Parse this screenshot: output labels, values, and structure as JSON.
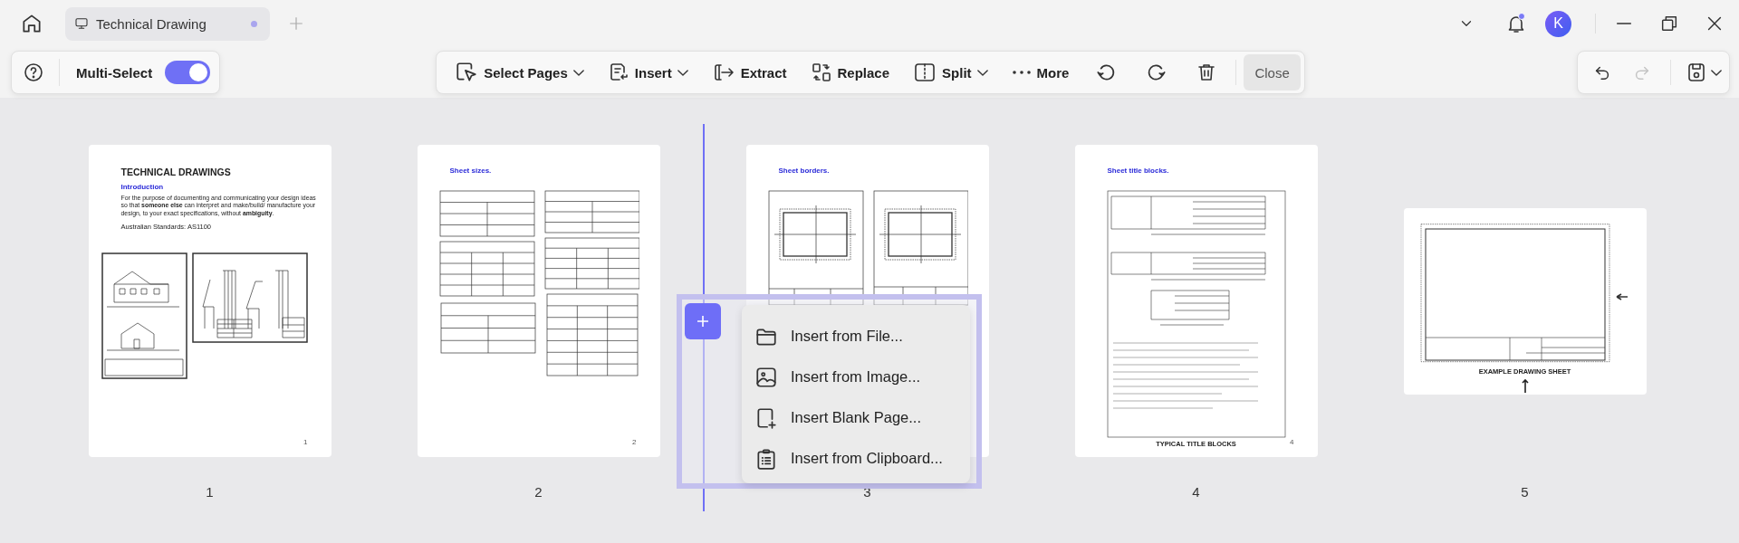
{
  "tab": {
    "title": "Technical Drawing",
    "unsaved": true
  },
  "notifications": {
    "unread": true
  },
  "avatar": {
    "initial": "K"
  },
  "multi_select": {
    "label": "Multi-Select",
    "on": true
  },
  "toolbar": [
    {
      "kind": "dropdown",
      "label": "Select Pages"
    },
    {
      "kind": "dropdown",
      "label": "Insert"
    },
    {
      "kind": "action",
      "label": "Extract"
    },
    {
      "kind": "action",
      "label": "Replace"
    },
    {
      "kind": "dropdown",
      "label": "Split"
    },
    {
      "kind": "action",
      "label": "More"
    },
    {
      "kind": "icon"
    },
    {
      "kind": "icon"
    },
    {
      "kind": "icon"
    },
    {
      "kind": "button",
      "label": "Close"
    }
  ],
  "history": {
    "undo": {
      "disabled": false
    },
    "redo": {
      "disabled": true
    }
  },
  "pages": [
    {
      "kind": "intro",
      "number": "1",
      "heading": "TECHNICAL DRAWINGS",
      "subheading": "Introduction",
      "paragraph": "For the purpose of documenting and communicating your design ideas so that **someone else** can interpret and make/build/ manufacture your design, to your exact specifications, without **ambiguity**.",
      "note": "Australian Standards:  AS1100",
      "corner": "1",
      "insert_before": false
    },
    {
      "kind": "tables",
      "number": "2",
      "heading": "Sheet sizes.",
      "corner": "2",
      "insert_before": false
    },
    {
      "kind": "borders",
      "number": "3",
      "heading": "Sheet borders.",
      "insert_before": true
    },
    {
      "kind": "title-blocks",
      "number": "4",
      "heading": "Sheet title blocks.",
      "caption": "TYPICAL TITLE BLOCKS",
      "corner": "4",
      "insert_before": false
    },
    {
      "kind": "landscape",
      "number": "5",
      "caption": "EXAMPLE DRAWING SHEET",
      "insert_before": false
    }
  ],
  "insert_menu": {
    "items": [
      {
        "label": "Insert from File..."
      },
      {
        "label": "Insert from Image..."
      },
      {
        "label": "Insert Blank Page..."
      },
      {
        "label": "Insert from Clipboard..."
      }
    ]
  }
}
